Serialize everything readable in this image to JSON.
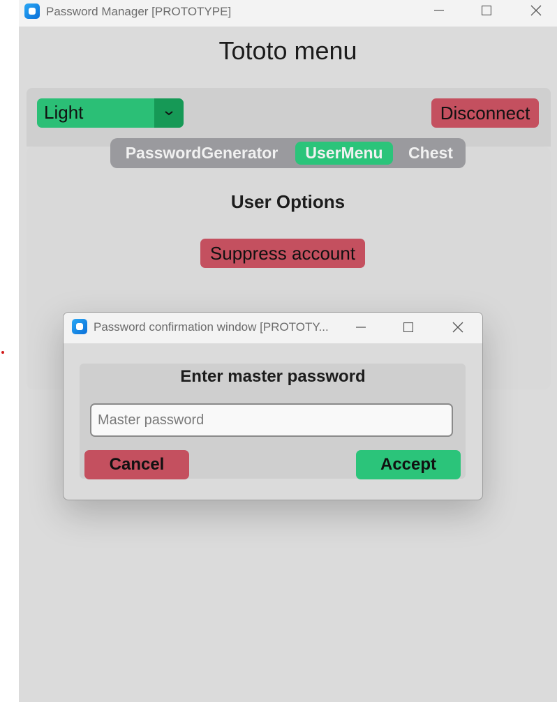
{
  "window": {
    "title": "Password Manager [PROTOTYPE]",
    "icon": "app-icon",
    "controls": [
      "minimize-icon",
      "maximize-icon",
      "close-icon"
    ]
  },
  "menu": {
    "title": "Tototo menu",
    "theme_selector": {
      "value": "Light",
      "icon": "chevron-down-icon"
    },
    "disconnect_label": "Disconnect",
    "tabs": [
      {
        "label": "PasswordGenerator",
        "active": false
      },
      {
        "label": "UserMenu",
        "active": true
      },
      {
        "label": "Chest",
        "active": false
      }
    ],
    "section_title": "User Options",
    "suppress_label": "Suppress account"
  },
  "dialog": {
    "title": "Password confirmation window [PROTOTY...",
    "heading": "Enter master password",
    "input": {
      "value": "",
      "placeholder": "Master password"
    },
    "cancel_label": "Cancel",
    "accept_label": "Accept"
  },
  "colors": {
    "accent_green": "#2bc47a",
    "dark_green": "#169956",
    "danger_red": "#c4505f",
    "background": "#dbdbdb",
    "segmented_bg": "#9a9a9e"
  }
}
